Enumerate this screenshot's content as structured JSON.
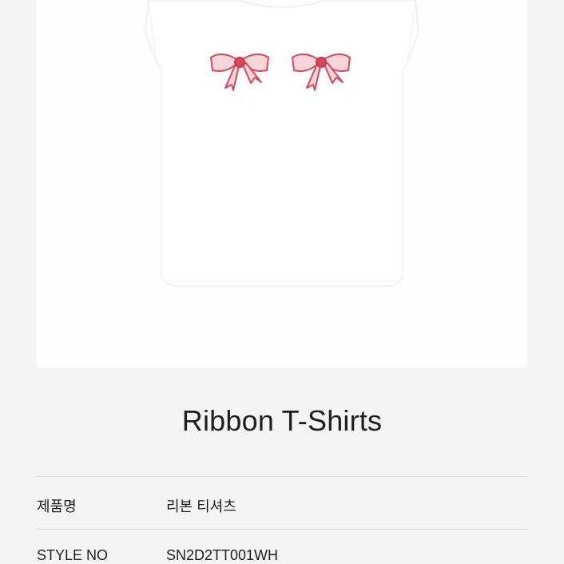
{
  "product": {
    "image_description_icon": "white-tshirt-with-red-ribbon-bows",
    "title": "Ribbon T-Shirts"
  },
  "specs": [
    {
      "label": "제품명",
      "value": "리본 티셔츠"
    },
    {
      "label": "STYLE NO",
      "value": "SN2D2TT001WH"
    }
  ],
  "colors": {
    "background": "#f4f4f4",
    "card": "#fefefe",
    "ribbon": "#d9485a",
    "text": "#1e1e1e"
  }
}
